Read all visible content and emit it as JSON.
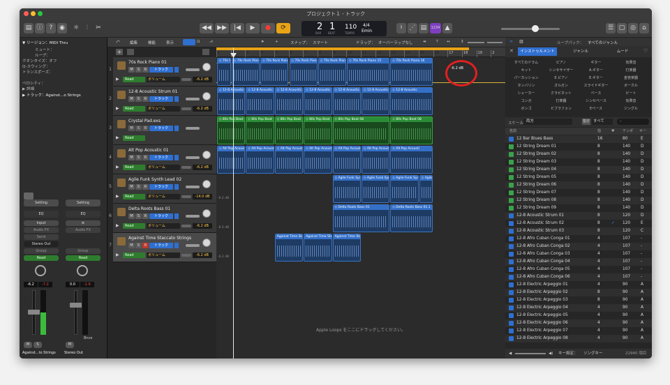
{
  "window": {
    "title": "プロジェクト１ - トラック"
  },
  "transport": {
    "bar": "2",
    "beat": "1",
    "tempo": "110",
    "sig": "4/4",
    "key": "Emin",
    "lcd_bar_label": "BAR",
    "lcd_beat_label": "BEAT",
    "tempo_label": "TEMPO",
    "cpu": "1234"
  },
  "inspector": {
    "region": "▼ リージョン：MIDI Thru",
    "mute": "ミュート：",
    "loop": "ループ：",
    "quantize": "クオンタイズ：オフ",
    "qswing": "Q-スウィング：",
    "transpose": "トランスポーズ：",
    "velocity": "ベロシティ：",
    "detail": "▶ 詳細",
    "track": "▶ トラック：Against...o Strings",
    "setting_a": "Setting",
    "setting_b": "Setting",
    "eq_a": "EQ",
    "eq_b": "EQ",
    "input": "Input",
    "audio_fx_a": "Audio FX",
    "audio_fx_b": "Audio FX",
    "send": "Send",
    "stereo_out": "Stereo Out",
    "group_a": "Group",
    "group_b": "Group",
    "read_a": "Read",
    "read_b": "Read",
    "val1": "-6.2",
    "val2": "-7.2",
    "val3": "0.0",
    "val4": "-1.6",
    "m": "M",
    "s": "S",
    "m2": "M",
    "bnce": "Bnce",
    "strip_a": "Against...to Strings",
    "strip_b": "Stereo Out"
  },
  "trackmenu": {
    "edit": "編集",
    "func": "機能",
    "view": "表示",
    "snap": "スナップ：",
    "snap_val": "スマート",
    "drag": "ドラッグ：",
    "drag_val": "オーバーラップなし"
  },
  "tracks": [
    {
      "num": "1",
      "name": "70s Rock Piano 01",
      "volume": "-6.2 dB"
    },
    {
      "num": "2",
      "name": "12-8 Acoustic Strum 01",
      "volume": "-6.2 dB"
    },
    {
      "num": "3",
      "name": "Crystal Pad.exs",
      "volume": ""
    },
    {
      "num": "4",
      "name": "Alt Pop Acoustic 01",
      "volume": "-6.2 dB"
    },
    {
      "num": "5",
      "name": "Agile Funk Synth Lead 02",
      "volume": "-14.0 dB"
    },
    {
      "num": "6",
      "name": "Delta Roots Bass 01",
      "volume": "-6.2 dB"
    },
    {
      "num": "7",
      "name": "Against Time Staccato Strings",
      "volume": "-6.2 dB"
    }
  ],
  "track_labels": {
    "m": "M",
    "s": "S",
    "r": "R",
    "track": "トラック",
    "read": "Read",
    "vol": "ボリューム"
  },
  "ruler": [
    "1",
    "2",
    "3",
    "4",
    "5",
    "6",
    "7",
    "8",
    "9",
    "10",
    "11",
    "12",
    "13",
    "14",
    "15",
    "16",
    "17",
    "18",
    "19",
    "2"
  ],
  "regions": [
    {
      "lane": 0,
      "start": 1,
      "len": 1,
      "label": "◇ 70s Rock Pian",
      "color": "blue"
    },
    {
      "lane": 0,
      "start": 2,
      "len": 2,
      "label": "◇ 70s Rock Pian",
      "color": "blue"
    },
    {
      "lane": 0,
      "start": 4,
      "len": 2,
      "label": "◇ 70s Rock Pian",
      "color": "blue"
    },
    {
      "lane": 0,
      "start": 6,
      "len": 2,
      "label": "◇ 70s Rock Pian",
      "color": "blue"
    },
    {
      "lane": 0,
      "start": 8,
      "len": 2,
      "label": "◇ 70s Rock Pian",
      "color": "blue"
    },
    {
      "lane": 0,
      "start": 10,
      "len": 3,
      "label": "◇ 70s Rock Piano 15",
      "color": "blue"
    },
    {
      "lane": 0,
      "start": 13,
      "len": 3,
      "label": "◇ 70s Rock Piano 16",
      "color": "blue"
    },
    {
      "lane": 1,
      "start": 1,
      "len": 2,
      "label": "◇ 12-8 Acoustic",
      "color": "blue"
    },
    {
      "lane": 1,
      "start": 3,
      "len": 2,
      "label": "◇ 12-8 Acoustic",
      "color": "blue"
    },
    {
      "lane": 1,
      "start": 5,
      "len": 2,
      "label": "◇ 12-8 Acoustic",
      "color": "blue"
    },
    {
      "lane": 1,
      "start": 7,
      "len": 2,
      "label": "◇ 12-8 Acoustic",
      "color": "blue"
    },
    {
      "lane": 1,
      "start": 9,
      "len": 2,
      "label": "◇ 12-8 Acoustic",
      "color": "blue"
    },
    {
      "lane": 1,
      "start": 11,
      "len": 2,
      "label": "◇ 12-8 Acoustic",
      "color": "blue"
    },
    {
      "lane": 1,
      "start": 13,
      "len": 3,
      "label": "◇ 12-8 Acoustic",
      "color": "blue"
    },
    {
      "lane": 2,
      "start": 1,
      "len": 2,
      "label": "◇ 80s Pop Beat",
      "color": "green"
    },
    {
      "lane": 2,
      "start": 3,
      "len": 2,
      "label": "◇ 80s Pop Beat",
      "color": "green"
    },
    {
      "lane": 2,
      "start": 5,
      "len": 2,
      "label": "◇ 80s Pop Beat",
      "color": "green"
    },
    {
      "lane": 2,
      "start": 7,
      "len": 2,
      "label": "◇ 80s Pop Beat",
      "color": "green"
    },
    {
      "lane": 2,
      "start": 9,
      "len": 4,
      "label": "◇ 80s Pop Beat 08",
      "color": "green"
    },
    {
      "lane": 2,
      "start": 13,
      "len": 3,
      "label": "◇ 80s Pop Beat 08",
      "color": "green"
    },
    {
      "lane": 3,
      "start": 1,
      "len": 2,
      "label": "◇ Alt Pop Acousti",
      "color": "blue"
    },
    {
      "lane": 3,
      "start": 3,
      "len": 2,
      "label": "◇ Alt Pop Acousti",
      "color": "blue"
    },
    {
      "lane": 3,
      "start": 5,
      "len": 2,
      "label": "◇ Alt Pop Acousti",
      "color": "blue"
    },
    {
      "lane": 3,
      "start": 7,
      "len": 2,
      "label": "◇ Alt Pop Acousti",
      "color": "blue"
    },
    {
      "lane": 3,
      "start": 9,
      "len": 2,
      "label": "◇ Alt Pop Acousti",
      "color": "blue"
    },
    {
      "lane": 3,
      "start": 11,
      "len": 2,
      "label": "◇ Alt Pop Acousti",
      "color": "blue"
    },
    {
      "lane": 3,
      "start": 13,
      "len": 3,
      "label": "◇ Alt Pop Acousti",
      "color": "blue"
    },
    {
      "lane": 4,
      "start": 9,
      "len": 2,
      "label": "◇ Agile Funk Syn",
      "color": "blue"
    },
    {
      "lane": 4,
      "start": 11,
      "len": 2,
      "label": "◇ Agile Funk Syn",
      "color": "blue"
    },
    {
      "lane": 4,
      "start": 13,
      "len": 2,
      "label": "◇ Agile Funk Syn",
      "color": "blue"
    },
    {
      "lane": 4,
      "start": 15,
      "len": 1,
      "label": "◇ Agile Funk Syn",
      "color": "blue"
    },
    {
      "lane": 5,
      "start": 9,
      "len": 4,
      "label": "◇ Delta Roots Bass 01",
      "color": "blue"
    },
    {
      "lane": 5,
      "start": 13,
      "len": 3,
      "label": "◇ Delta Roots Bass 01.1",
      "color": "blue"
    },
    {
      "lane": 6,
      "start": 5,
      "len": 2,
      "label": "Against Time Sta",
      "color": "blue"
    },
    {
      "lane": 6,
      "start": 7,
      "len": 2,
      "label": "Against Time Sta",
      "color": "blue"
    },
    {
      "lane": 6,
      "start": 9,
      "len": 2,
      "label": "Against Time Sta",
      "color": "blue"
    }
  ],
  "drop_hint": "Apple Loops をここにドラッグしてください。",
  "automation_db": "-6.2 dB",
  "lane_db": "-6.2 dB",
  "browser": {
    "loops_label": "ループパック：",
    "loops_value": "すべてのジャンル",
    "tabs": [
      "インストゥルメント",
      "ジャンル",
      "ムード"
    ],
    "categories": [
      [
        "すべてのドラム",
        "ピアノ",
        "ギター",
        "効果音"
      ],
      [
        "キット",
        "シンセサイザー",
        "A.ギター",
        "打楽器"
      ],
      [
        "パーカッション",
        "E.ピアノ",
        "E.ギター",
        "金管楽器"
      ],
      [
        "タンバリン",
        "オルガン",
        "スライドギター",
        "ボーカル"
      ],
      [
        "シェーカー",
        "クラビネット",
        "ベース",
        "ビート"
      ],
      [
        "コンガ",
        "打楽器",
        "シンセベース",
        "効果音"
      ],
      [
        "ボンゴ",
        "ビブラフォン",
        "Eベース",
        "ジングル"
      ]
    ],
    "scale_label": "スケール：",
    "scale_value": "両方",
    "sig_label": "拍子",
    "sig_value": "すべて",
    "col_name": "名前",
    "col_beats": "拍",
    "col_tempo": "テンポ",
    "col_key": "キー",
    "rows": [
      {
        "name": "12 Bar Blues Bass",
        "beats": "16",
        "fav": "",
        "tempo": "80",
        "key": "E",
        "icon": "blue"
      },
      {
        "name": "12 String Dream 01",
        "beats": "8",
        "fav": "",
        "tempo": "140",
        "key": "D",
        "icon": "green"
      },
      {
        "name": "12 String Dream 02",
        "beats": "8",
        "fav": "",
        "tempo": "140",
        "key": "D",
        "icon": "green"
      },
      {
        "name": "12 String Dream 03",
        "beats": "8",
        "fav": "",
        "tempo": "140",
        "key": "D",
        "icon": "green"
      },
      {
        "name": "12 String Dream 04",
        "beats": "8",
        "fav": "",
        "tempo": "140",
        "key": "D",
        "icon": "green"
      },
      {
        "name": "12 String Dream 05",
        "beats": "8",
        "fav": "",
        "tempo": "140",
        "key": "D",
        "icon": "green"
      },
      {
        "name": "12 String Dream 06",
        "beats": "8",
        "fav": "",
        "tempo": "140",
        "key": "D",
        "icon": "green"
      },
      {
        "name": "12 String Dream 07",
        "beats": "8",
        "fav": "",
        "tempo": "140",
        "key": "D",
        "icon": "green"
      },
      {
        "name": "12 String Dream 08",
        "beats": "8",
        "fav": "",
        "tempo": "140",
        "key": "D",
        "icon": "green"
      },
      {
        "name": "12 String Dream 09",
        "beats": "8",
        "fav": "",
        "tempo": "140",
        "key": "D",
        "icon": "green"
      },
      {
        "name": "12-8 Acoustic Strum 01",
        "beats": "8",
        "fav": "",
        "tempo": "120",
        "key": "D",
        "icon": "blue"
      },
      {
        "name": "12-8 Acoustic Strum 02",
        "beats": "8",
        "fav": "✓",
        "tempo": "120",
        "key": "E",
        "icon": "blue"
      },
      {
        "name": "12-8 Acoustic Strum 03",
        "beats": "8",
        "fav": "",
        "tempo": "120",
        "key": "C",
        "icon": "blue"
      },
      {
        "name": "12-8 Afro Cuban Conga 01",
        "beats": "4",
        "fav": "",
        "tempo": "107",
        "key": "-",
        "icon": "blue"
      },
      {
        "name": "12-8 Afro Cuban Conga 02",
        "beats": "4",
        "fav": "",
        "tempo": "107",
        "key": "-",
        "icon": "blue"
      },
      {
        "name": "12-8 Afro Cuban Conga 03",
        "beats": "4",
        "fav": "",
        "tempo": "107",
        "key": "-",
        "icon": "blue"
      },
      {
        "name": "12-8 Afro Cuban Conga 04",
        "beats": "4",
        "fav": "",
        "tempo": "107",
        "key": "-",
        "icon": "blue"
      },
      {
        "name": "12-8 Afro Cuban Conga 05",
        "beats": "4",
        "fav": "",
        "tempo": "107",
        "key": "-",
        "icon": "blue"
      },
      {
        "name": "12-8 Afro Cuban Conga 06",
        "beats": "4",
        "fav": "",
        "tempo": "107",
        "key": "-",
        "icon": "blue"
      },
      {
        "name": "12-8 Electric Arpeggio 01",
        "beats": "4",
        "fav": "",
        "tempo": "90",
        "key": "A",
        "icon": "blue"
      },
      {
        "name": "12-8 Electric Arpeggio 02",
        "beats": "8",
        "fav": "",
        "tempo": "90",
        "key": "A",
        "icon": "blue"
      },
      {
        "name": "12-8 Electric Arpeggio 03",
        "beats": "8",
        "fav": "",
        "tempo": "90",
        "key": "A",
        "icon": "blue"
      },
      {
        "name": "12-8 Electric Arpeggio 04",
        "beats": "4",
        "fav": "",
        "tempo": "90",
        "key": "A",
        "icon": "blue"
      },
      {
        "name": "12-8 Electric Arpeggio 05",
        "beats": "4",
        "fav": "",
        "tempo": "90",
        "key": "A",
        "icon": "blue"
      },
      {
        "name": "12-8 Electric Arpeggio 06",
        "beats": "4",
        "fav": "",
        "tempo": "90",
        "key": "A",
        "icon": "blue"
      },
      {
        "name": "12-8 Electric Arpeggio 07",
        "beats": "4",
        "fav": "",
        "tempo": "90",
        "key": "A",
        "icon": "blue"
      },
      {
        "name": "12-8 Electric Arpeggio 08",
        "beats": "4",
        "fav": "",
        "tempo": "90",
        "key": "A",
        "icon": "blue"
      }
    ],
    "footer_key": "キー設定：",
    "footer_song": "ソングキー",
    "footer_count": "22940 項目"
  }
}
